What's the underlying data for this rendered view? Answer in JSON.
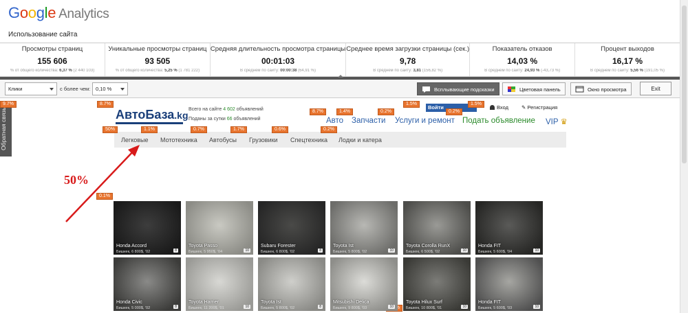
{
  "ga": {
    "logo_google": [
      "G",
      "o",
      "o",
      "g",
      "l",
      "e"
    ],
    "logo_analytics": "Analytics",
    "subtitle": "Использование сайта"
  },
  "stats": [
    {
      "label": "Просмотры страниц",
      "value": "155 606",
      "sub_prefix": "% от общего количества:",
      "sub_bold": "6,37 %",
      "sub_suffix": "(2 440 103)"
    },
    {
      "label": "Уникальные просмотры страниц",
      "value": "93 505",
      "sub_prefix": "% от общего количества:",
      "sub_bold": "5,25 %",
      "sub_suffix": "(1 781 222)"
    },
    {
      "label": "Средняя длительность просмотра страницы",
      "value": "00:01:03",
      "sub_prefix": "В среднем по сайту:",
      "sub_bold": "00:00:38",
      "sub_suffix": "(64,91 %)"
    },
    {
      "label": "Среднее время загрузки страницы (сек.)",
      "value": "9,78",
      "sub_prefix": "В среднем по сайту:",
      "sub_bold": "3,81",
      "sub_suffix": "(156,82 %)"
    },
    {
      "label": "Показатель отказов",
      "value": "14,03 %",
      "sub_prefix": "В среднем по сайту:",
      "sub_bold": "24,93 %",
      "sub_suffix": "(-43,73 %)"
    },
    {
      "label": "Процент выходов",
      "value": "16,17 %",
      "sub_prefix": "В среднем по сайту:",
      "sub_bold": "5,56 %",
      "sub_suffix": "(191,05 %)"
    }
  ],
  "toolbar": {
    "metric_select": "Клики",
    "more_than_label": "с более чем:",
    "threshold_select": "0,10 %",
    "btn_tooltips": "Всплывающие подсказки",
    "btn_color_panel": "Цветовая панель",
    "btn_view_window": "Окно просмотра",
    "exit": "Exit"
  },
  "feedback_tab": "Обратная связь",
  "site": {
    "logo_main": "АвтоБаза",
    "logo_tld": ".kg",
    "total_prefix": "Всего на сайте",
    "total_count": "4 602",
    "total_suffix": "объявлений",
    "daily_prefix": "Поданы за сутки",
    "daily_count": "66",
    "daily_suffix": "объявлений",
    "vk_label": "Войти",
    "login": "Вход",
    "register": "Регистрация",
    "nav": [
      "Авто",
      "Запчасти",
      "Услуги и ремонт",
      "Подать объявление",
      "VIP"
    ],
    "categories": [
      "Легковые",
      "Мототехника",
      "Автобусы",
      "Грузовики",
      "Спецтехника",
      "Лодки и катера"
    ]
  },
  "badges": [
    "9.7%",
    "8.7%",
    "8.7%",
    "1.4%",
    "0.2%",
    "1.5%",
    "1.5%",
    "0.2%",
    "50%",
    "1.1%",
    "0.7%",
    "1.7%",
    "0.6%",
    "0.2%",
    "0.1%",
    "0.1%"
  ],
  "annotation": "50%",
  "cars": [
    {
      "name": "Honda Accord",
      "price": "Бишкек, 6 800$, '02",
      "count": "8"
    },
    {
      "name": "Toyota Passo",
      "price": "Бишкек, 5 950$, '04",
      "count": "10"
    },
    {
      "name": "Subaru Forester",
      "price": "Бишкек, 6 800$, '02",
      "count": "8"
    },
    {
      "name": "Toyota Ist",
      "price": "Бишкек, 5 800$, '02",
      "count": "10"
    },
    {
      "name": "Toyota Corolla RunX",
      "price": "Бишкек, 6 500$, '02",
      "count": "10"
    },
    {
      "name": "Honda FIT",
      "price": "Бишкек, 5 600$, '04",
      "count": "10"
    },
    {
      "name": "Honda Civic",
      "price": "Бишкек, 5 000$, '02",
      "count": "8"
    },
    {
      "name": "Toyota Harrier",
      "price": "Бишкек, 11 200$, '01",
      "count": "10"
    },
    {
      "name": "Toyota Ist",
      "price": "Бишкек, 5 800$, '02",
      "count": "8"
    },
    {
      "name": "Mitsubishi Delica",
      "price": "Бишкек, 9 800$, '03",
      "count": "10"
    },
    {
      "name": "Toyota Hilux Surf",
      "price": "Бишкек, 10 800$, '01",
      "count": "10"
    },
    {
      "name": "Honda FIT",
      "price": "Бишкек, 5 600$, '03",
      "count": "10"
    }
  ],
  "colors": {
    "badge": "#e8742e",
    "site_blue": "#2c5fa8",
    "annotation_red": "#d81a1a"
  }
}
